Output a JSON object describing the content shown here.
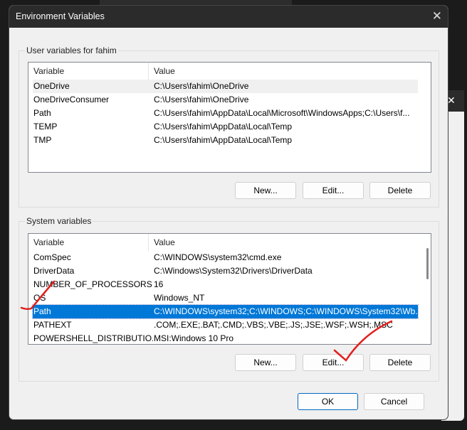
{
  "dialog": {
    "title": "Environment Variables"
  },
  "user_vars": {
    "label": "User variables for fahim",
    "headers": [
      "Variable",
      "Value"
    ],
    "rows": [
      [
        "OneDrive",
        "C:\\Users\\fahim\\OneDrive"
      ],
      [
        "OneDriveConsumer",
        "C:\\Users\\fahim\\OneDrive"
      ],
      [
        "Path",
        "C:\\Users\\fahim\\AppData\\Local\\Microsoft\\WindowsApps;C:\\Users\\f..."
      ],
      [
        "TEMP",
        "C:\\Users\\fahim\\AppData\\Local\\Temp"
      ],
      [
        "TMP",
        "C:\\Users\\fahim\\AppData\\Local\\Temp"
      ]
    ],
    "buttons": {
      "new": "New...",
      "edit": "Edit...",
      "delete": "Delete"
    }
  },
  "system_vars": {
    "label": "System variables",
    "headers": [
      "Variable",
      "Value"
    ],
    "rows": [
      [
        "ComSpec",
        "C:\\WINDOWS\\system32\\cmd.exe"
      ],
      [
        "DriverData",
        "C:\\Windows\\System32\\Drivers\\DriverData"
      ],
      [
        "NUMBER_OF_PROCESSORS",
        "16"
      ],
      [
        "OS",
        "Windows_NT"
      ],
      [
        "Path",
        "C:\\WINDOWS\\system32;C:\\WINDOWS;C:\\WINDOWS\\System32\\Wb..."
      ],
      [
        "PATHEXT",
        ".COM;.EXE;.BAT;.CMD;.VBS;.VBE;.JS;.JSE;.WSF;.WSH;.MSC"
      ],
      [
        "POWERSHELL_DISTRIBUTIO...",
        "MSI:Windows 10 Pro"
      ]
    ],
    "selected": "Path",
    "buttons": {
      "new": "New...",
      "edit": "Edit...",
      "delete": "Delete"
    }
  },
  "footer": {
    "ok": "OK",
    "cancel": "Cancel"
  },
  "colors": {
    "selection": "#0078d7",
    "annotation": "#e0201c"
  }
}
